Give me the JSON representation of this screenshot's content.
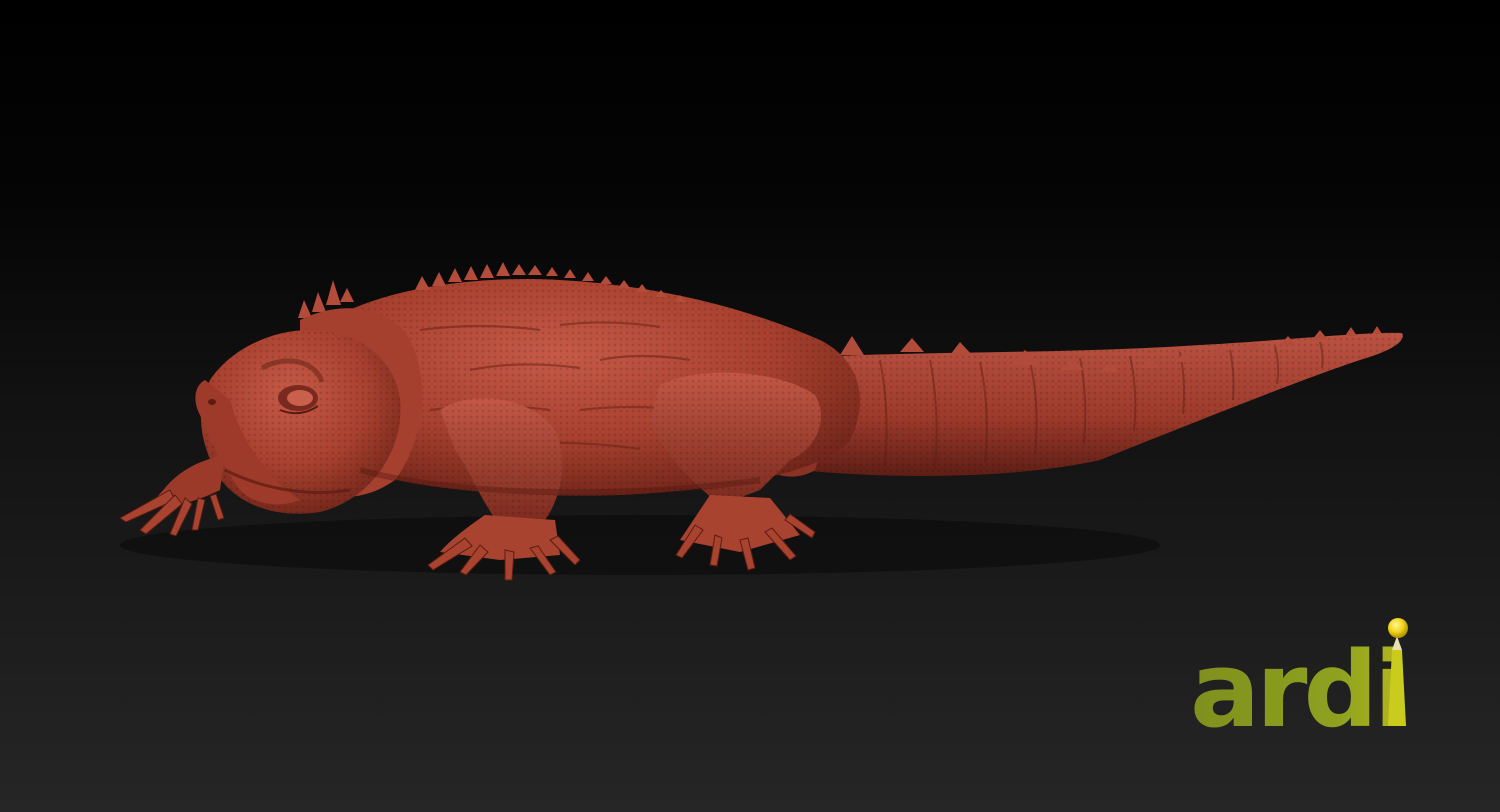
{
  "scene": {
    "subject_icon": "tuatara-sculpt-render",
    "background_colors": [
      "#000000",
      "#262626"
    ],
    "sculpt_color": "#b4483a"
  },
  "logo": {
    "text": "ardi",
    "text_color": "#8a9a1f",
    "text_color_light": "#c9cc1c",
    "pin_color": "#f2d51a"
  }
}
